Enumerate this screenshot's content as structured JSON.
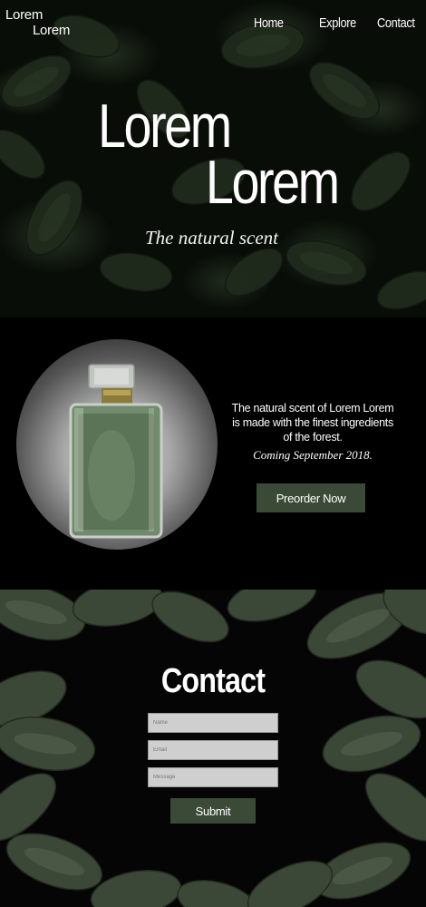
{
  "brand": {
    "line1": "Lorem",
    "line2": "Lorem"
  },
  "nav": {
    "items": [
      {
        "label": "Home"
      },
      {
        "label": "Explore"
      },
      {
        "label": "Contact"
      }
    ]
  },
  "hero": {
    "title_line1": "Lorem",
    "title_line2": "Lorem",
    "tagline": "The natural scent"
  },
  "product": {
    "description": "The natural scent of Lorem Lorem is made with the finest ingredients of the forest.",
    "coming": "Coming September 2018.",
    "preorder_label": "Preorder Now"
  },
  "contact": {
    "title": "Contact",
    "name_placeholder": "Name",
    "email_placeholder": "Email",
    "message_placeholder": "Message",
    "submit_label": "Submit"
  },
  "colors": {
    "accent": "#3a4a36",
    "background": "#000000",
    "field": "#cfcfcf"
  }
}
